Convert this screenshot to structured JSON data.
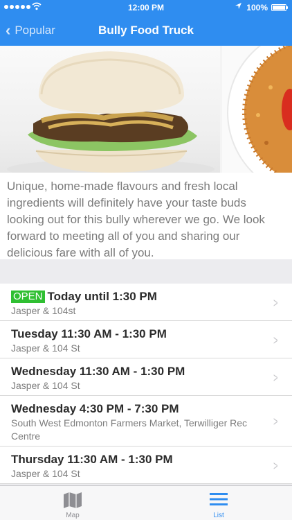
{
  "colors": {
    "accent": "#2f8df0",
    "open_badge": "#2fbf32",
    "background": "#ececef"
  },
  "status_bar": {
    "time": "12:00 PM",
    "battery": "100%"
  },
  "nav": {
    "back_label": "Popular",
    "title": "Bully Food Truck",
    "back_icon": "chevron-left-icon"
  },
  "gallery": {
    "images": [
      "burger",
      "rice dish"
    ]
  },
  "description": "Unique, home-made flavours and fresh local ingredients will definitely have your taste buds looking out for this bully wherever we go. We look forward to meeting all of you and sharing our delicious fare with all of you.",
  "schedule": [
    {
      "badge": "OPEN",
      "when": "Today until 1:30 PM",
      "where": "Jasper & 104st"
    },
    {
      "when": "Tuesday 11:30 AM - 1:30 PM",
      "where": "Jasper & 104 St"
    },
    {
      "when": "Wednesday 11:30 AM - 1:30 PM",
      "where": "Jasper & 104 St"
    },
    {
      "when": "Wednesday 4:30 PM - 7:30 PM",
      "where": "South West Edmonton Farmers Market, Terwilliger Rec Centre"
    },
    {
      "when": "Thursday 11:30 AM - 1:30 PM",
      "where": "Jasper & 104 St"
    }
  ],
  "tabs": [
    {
      "label": "Map",
      "icon": "map-icon",
      "selected": false
    },
    {
      "label": "List",
      "icon": "list-icon",
      "selected": true
    }
  ]
}
